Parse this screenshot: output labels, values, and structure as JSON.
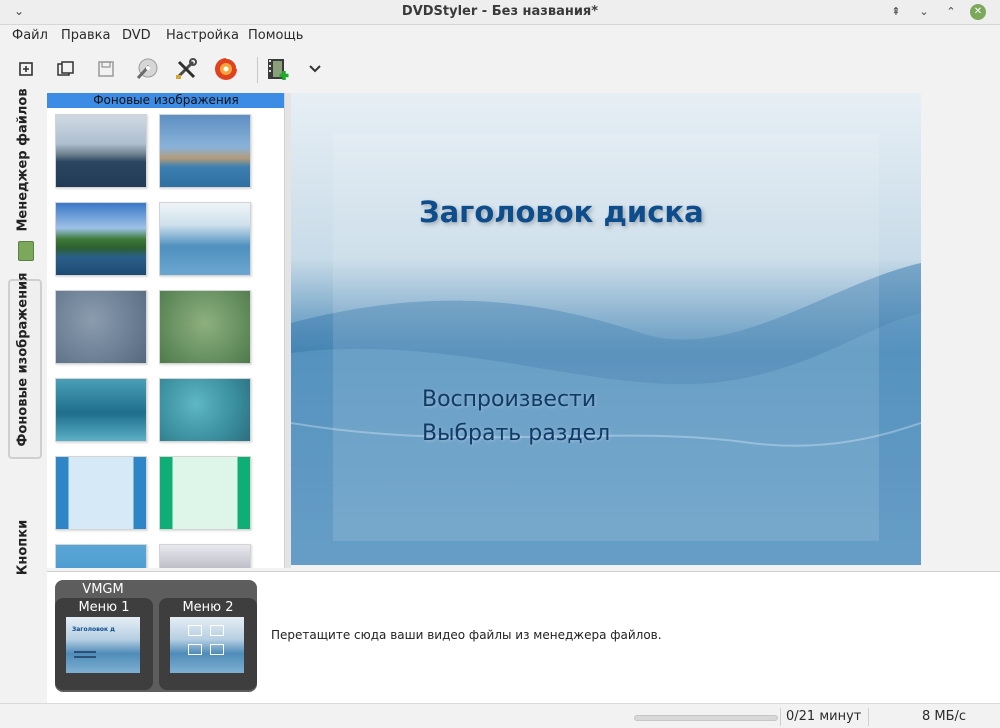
{
  "window": {
    "title": "DVDStyler - Без названия*",
    "controls": [
      "minimize",
      "maximize",
      "restore",
      "close"
    ]
  },
  "menubar": {
    "items": [
      "Файл",
      "Правка",
      "DVD",
      "Настройка",
      "Помощь"
    ]
  },
  "toolbar": {
    "tools": [
      "new-icon",
      "open-icon",
      "save-icon",
      "burn-wand-icon",
      "settings-tools-icon",
      "burn-disc-icon",
      "add-video-icon",
      "chevron-down-icon"
    ]
  },
  "side_tabs": {
    "file_manager": "Менеджер файлов",
    "backgrounds": "Фоновые изображения",
    "buttons": "Кнопки"
  },
  "backgrounds_panel": {
    "header": "Фоновые изображения"
  },
  "preview": {
    "disk_title": "Заголовок диска",
    "buttons": [
      "Воспроизвести",
      "Выбрать раздел"
    ]
  },
  "titleset": {
    "vmgm_label": "VMGM",
    "menus": [
      {
        "label": "Меню 1",
        "thumb_text": "Заголовок д"
      },
      {
        "label": "Меню 2"
      }
    ],
    "drop_hint": "Перетащите сюда ваши видео файлы из менеджера файлов."
  },
  "status": {
    "progress_fraction": 0,
    "duration": "0/21 минут",
    "bitrate": "8 МБ/с"
  },
  "colors": {
    "selection": "#3c8ce6",
    "accent_green": "#7ba85a",
    "disk_title": "#0e4d8c"
  }
}
